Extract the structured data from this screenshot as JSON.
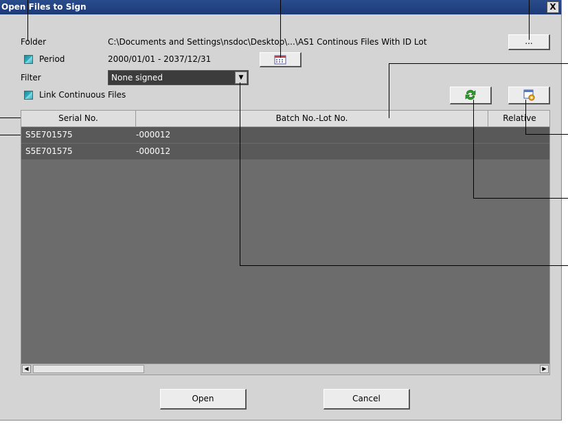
{
  "window": {
    "title": "Open Files to Sign",
    "close_glyph": "X"
  },
  "folder": {
    "label": "Folder",
    "path": "C:\\Documents and Settings\\nsdoc\\Desktop\\...\\AS1 Continous Files With ID Lot",
    "browse_label": "..."
  },
  "period": {
    "label": "Period",
    "range": "2000/01/01 - 2037/12/31",
    "checked": true
  },
  "filter": {
    "label": "Filter",
    "selected": "None signed"
  },
  "link_continuous": {
    "label": "Link Continuous Files",
    "checked": true
  },
  "table": {
    "columns": [
      "Serial No.",
      "Batch No.-Lot No.",
      "Relative"
    ],
    "rows": [
      {
        "serial": "S5E701575",
        "batch": "-000012"
      },
      {
        "serial": "S5E701575",
        "batch": "-000012"
      }
    ]
  },
  "buttons": {
    "open": "Open",
    "cancel": "Cancel"
  },
  "icons": {
    "calendar": "calendar-icon",
    "refresh": "refresh-icon",
    "settings": "settings-icon",
    "dropdown": "chevron-down-icon"
  },
  "colors": {
    "title_bar": "#1c3a78",
    "dialog_bg": "#d4d4d4",
    "table_bg": "#6c6c6c",
    "row_bg": "#595959"
  }
}
